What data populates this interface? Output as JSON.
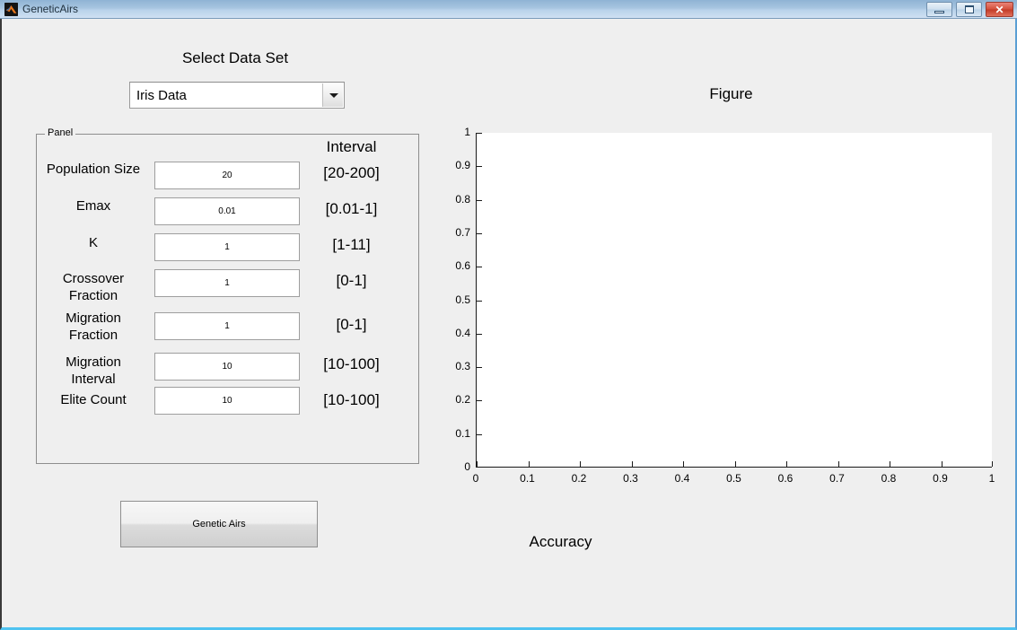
{
  "window": {
    "title": "GeneticAirs",
    "icon": "matlab-icon",
    "controls": {
      "minimize": "minimize-icon",
      "maximize": "maximize-icon",
      "close": "✕"
    }
  },
  "dataset": {
    "label": "Select Data Set",
    "selected": "Iris Data",
    "arrow": "chevron-down-icon"
  },
  "panel": {
    "title": "Panel",
    "interval_header": "Interval",
    "rows": [
      {
        "label": "Population Size",
        "value": "20",
        "interval": "[20-200]"
      },
      {
        "label": "Emax",
        "value": "0.01",
        "interval": "[0.01-1]"
      },
      {
        "label": "K",
        "value": "1",
        "interval": "[1-11]"
      },
      {
        "label": "Crossover\nFraction",
        "value": "1",
        "interval": "[0-1]"
      },
      {
        "label": "Migration\nFraction",
        "value": "1",
        "interval": "[0-1]"
      },
      {
        "label": "Migration\nInterval",
        "value": "10",
        "interval": "[10-100]"
      },
      {
        "label": "Elite Count",
        "value": "10",
        "interval": "[10-100]"
      }
    ]
  },
  "run_button": {
    "label": "Genetic Airs"
  },
  "figure": {
    "title": "Figure",
    "caption": "Accuracy"
  },
  "chart_data": {
    "type": "line",
    "title": "Figure",
    "xlabel": "",
    "ylabel": "",
    "caption": "Accuracy",
    "xlim": [
      0,
      1
    ],
    "ylim": [
      0,
      1
    ],
    "xticks": [
      0,
      0.1,
      0.2,
      0.3,
      0.4,
      0.5,
      0.6,
      0.7,
      0.8,
      0.9,
      1
    ],
    "xtick_labels": [
      "0",
      "0.1",
      "0.2",
      "0.3",
      "0.4",
      "0.5",
      "0.6",
      "0.7",
      "0.8",
      "0.9",
      "1"
    ],
    "yticks": [
      0,
      0.1,
      0.2,
      0.3,
      0.4,
      0.5,
      0.6,
      0.7,
      0.8,
      0.9,
      1
    ],
    "ytick_labels": [
      "0",
      "0.1",
      "0.2",
      "0.3",
      "0.4",
      "0.5",
      "0.6",
      "0.7",
      "0.8",
      "0.9",
      "1"
    ],
    "grid": false,
    "legend": null,
    "series": [],
    "note": "empty axes - no data plotted"
  },
  "colors": {
    "window_background": "#efefef",
    "titlebar_top": "#8fb3d4",
    "titlebar_bottom": "#cfe0f2",
    "close_button": "#c23b28",
    "plot_background": "#ffffff",
    "bottom_border": "#4fc3f0"
  }
}
